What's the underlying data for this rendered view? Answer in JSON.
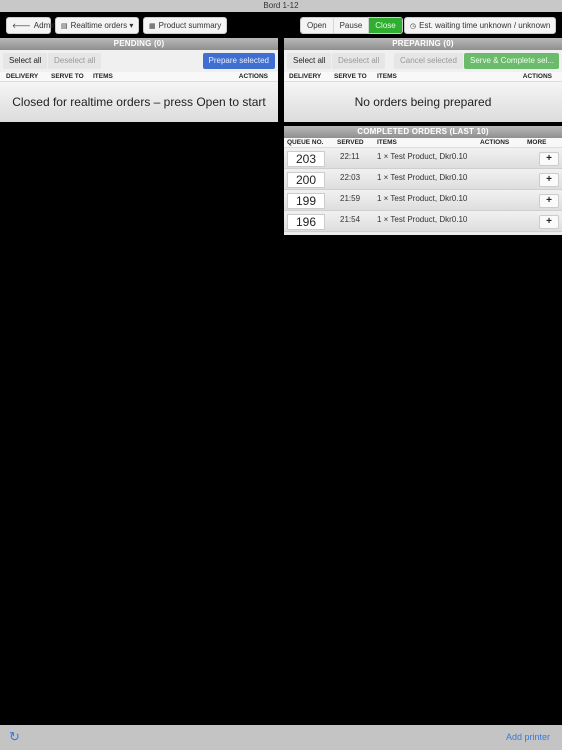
{
  "statusbar": {
    "title": "Bord 1-12"
  },
  "toolbar": {
    "admin": {
      "icon": "arrow-left-icon",
      "glyph": "🡐",
      "label": "Admin"
    },
    "realtime": {
      "icon": "list-icon",
      "glyph": "▤",
      "label": "Realtime orders",
      "caret": "▾"
    },
    "summary": {
      "icon": "grid-icon",
      "glyph": "▦",
      "label": "Product summary"
    },
    "mode": {
      "open": "Open",
      "pause": "Pause",
      "close": "Close",
      "active": "close"
    },
    "wait": {
      "icon": "clock-icon",
      "glyph": "◷",
      "label": "Est. waiting time unknown / unknown"
    }
  },
  "pending": {
    "title": "PENDING (0)",
    "select_all": "Select all",
    "deselect_all": "Deselect all",
    "prepare_selected": "Prepare selected",
    "columns": [
      "DELIVERY",
      "SERVE TO",
      "ITEMS",
      "ACTIONS"
    ],
    "empty_message": "Closed for realtime orders – press Open to start"
  },
  "preparing": {
    "title": "PREPARING (0)",
    "select_all": "Select all",
    "deselect_all": "Deselect all",
    "cancel_selected": "Cancel selected",
    "serve_complete": "Serve & Complete sel...",
    "columns": [
      "DELIVERY",
      "SERVE TO",
      "ITEMS",
      "ACTIONS"
    ],
    "empty_message": "No orders being prepared"
  },
  "completed": {
    "title": "COMPLETED ORDERS (LAST 10)",
    "columns": [
      "QUEUE NO.",
      "SERVED",
      "ITEMS",
      "ACTIONS",
      "MORE"
    ],
    "rows": [
      {
        "queue": "203",
        "served": "22:11",
        "items": "1 × Test Product, Dkr0.10",
        "more": "+"
      },
      {
        "queue": "200",
        "served": "22:03",
        "items": "1 × Test Product, Dkr0.10",
        "more": "+"
      },
      {
        "queue": "199",
        "served": "21:59",
        "items": "1 × Test Product, Dkr0.10",
        "more": "+"
      },
      {
        "queue": "196",
        "served": "21:54",
        "items": "1 × Test Product, Dkr0.10",
        "more": "+"
      }
    ]
  },
  "bottombar": {
    "refresh_icon": "refresh-icon",
    "refresh_glyph": "↻",
    "add_printer": "Add printer"
  },
  "colors": {
    "accent_blue": "#3f6fd1",
    "active_green": "#2fae2f",
    "complete_green": "#6cbb6c",
    "link_blue": "#3b78d8"
  }
}
